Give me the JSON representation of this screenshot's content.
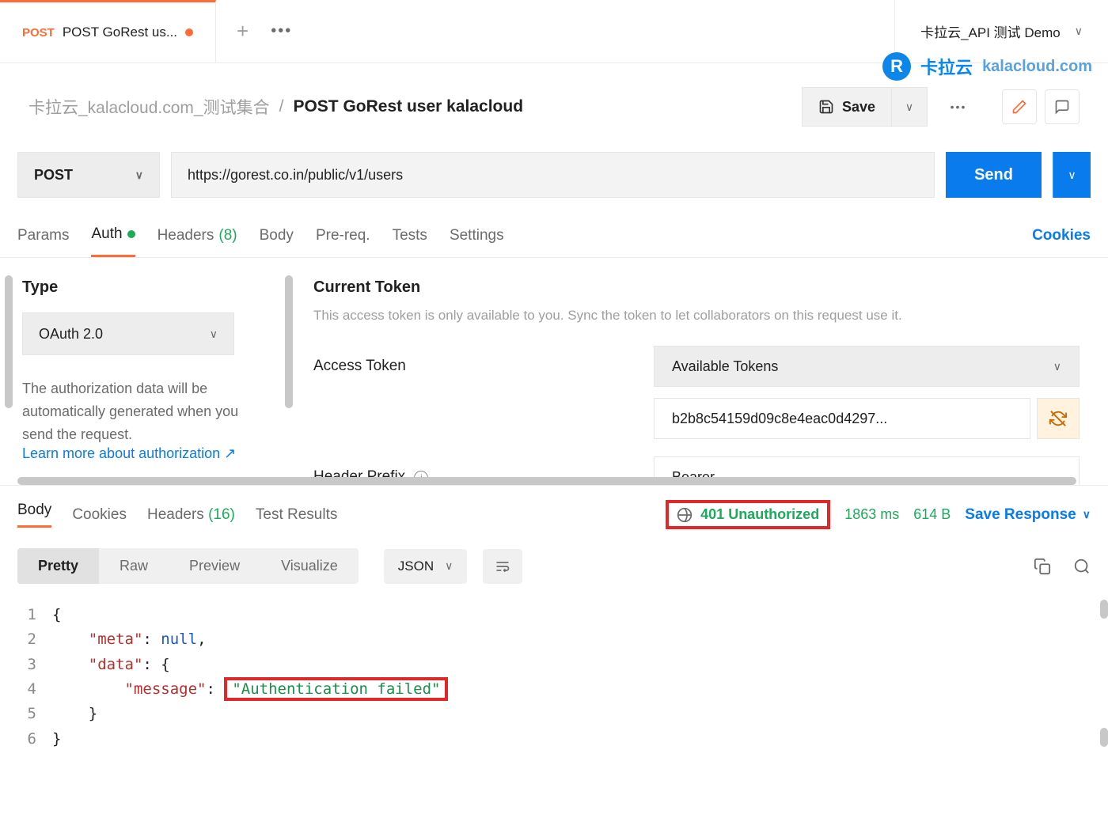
{
  "tab": {
    "method": "POST",
    "title": "POST GoRest us..."
  },
  "env_name": "卡拉云_API 测试 Demo",
  "logo": {
    "text1": "卡拉云",
    "text2": "kalacloud.com"
  },
  "breadcrumb": {
    "collection": "卡拉云_kalacloud.com_测试集合",
    "request": "POST GoRest user kalacloud"
  },
  "save_label": "Save",
  "method": "POST",
  "url": "https://gorest.co.in/public/v1/users",
  "send_label": "Send",
  "req_tabs": {
    "params": "Params",
    "auth": "Auth",
    "headers": "Headers",
    "headers_count": "(8)",
    "body": "Body",
    "prereq": "Pre-req.",
    "tests": "Tests",
    "settings": "Settings",
    "cookies": "Cookies"
  },
  "auth": {
    "type_label": "Type",
    "type_value": "OAuth 2.0",
    "desc": "The authorization data will be automatically generated when you send the request.",
    "learn_more": "Learn more about authorization ↗",
    "current_token": "Current Token",
    "hint": "This access token is only available to you. Sync the token to let collaborators on this request use it.",
    "access_token_label": "Access Token",
    "available_tokens": "Available Tokens",
    "token_value": "b2b8c54159d09c8e4eac0d4297...",
    "header_prefix_label": "Header Prefix",
    "header_prefix_value": "Bearer"
  },
  "resp_tabs": {
    "body": "Body",
    "cookies": "Cookies",
    "headers": "Headers",
    "headers_count": "(16)",
    "test_results": "Test Results"
  },
  "resp_meta": {
    "status": "401 Unauthorized",
    "time": "1863 ms",
    "size": "614 B",
    "save_response": "Save Response"
  },
  "view_modes": {
    "pretty": "Pretty",
    "raw": "Raw",
    "preview": "Preview",
    "visualize": "Visualize"
  },
  "format": "JSON",
  "code": {
    "l1": "{",
    "meta_key": "\"meta\"",
    "null_val": "null",
    "data_key": "\"data\"",
    "message_key": "\"message\"",
    "message_val": "\"Authentication failed\"",
    "l5": "    }",
    "l6": "}"
  }
}
